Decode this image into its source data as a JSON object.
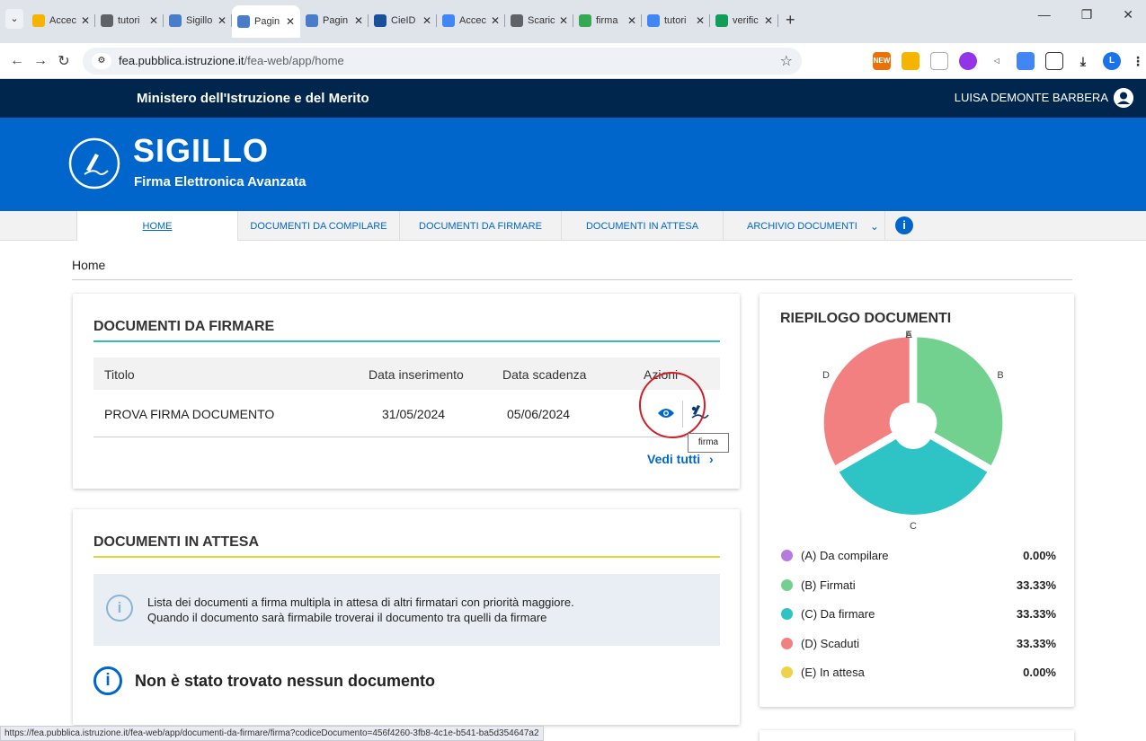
{
  "browser": {
    "tabs": [
      {
        "label": "Accec",
        "color": "#f4b400"
      },
      {
        "label": "tutori",
        "color": "#5f6368"
      },
      {
        "label": "Sigillo",
        "color": "#4a7cc9"
      },
      {
        "label": "Pagin",
        "color": "#4a7cc9"
      },
      {
        "label": "Pagin",
        "color": "#4a7cc9"
      },
      {
        "label": "CieID",
        "color": "#1a4f9c"
      },
      {
        "label": "Accec",
        "color": "#4285f4"
      },
      {
        "label": "Scaric",
        "color": "#5f6368"
      },
      {
        "label": "firma",
        "color": "#34a853"
      },
      {
        "label": "tutori",
        "color": "#4285f4"
      },
      {
        "label": "verific",
        "color": "#0f9d58"
      }
    ],
    "new_tab": "+",
    "url_host": "fea.pubblica.istruzione.it",
    "url_path": "/fea-web/app/home",
    "status_url": "https://fea.pubblica.istruzione.it/fea-web/app/documenti-da-firmare/firma?codiceDocumento=456f4260-3fb8-4c1e-b541-ba5d354647a2",
    "new_badge": "NEW",
    "profile_initial": "L"
  },
  "header": {
    "ministry": "Ministero dell'Istruzione e del Merito",
    "user": "LUISA DEMONTE BARBERA",
    "app_name": "SIGILLO",
    "app_subtitle": "Firma Elettronica Avanzata"
  },
  "nav": {
    "items": [
      "HOME",
      "DOCUMENTI DA COMPILARE",
      "DOCUMENTI DA FIRMARE",
      "DOCUMENTI IN ATTESA",
      "ARCHIVIO DOCUMENTI"
    ],
    "info": "i"
  },
  "breadcrumb": "Home",
  "firmare": {
    "title": "DOCUMENTI DA FIRMARE",
    "accent": "#2ebfbf",
    "columns": [
      "Titolo",
      "Data inserimento",
      "Data scadenza",
      "Azioni"
    ],
    "rows": [
      {
        "titolo": "PROVA FIRMA DOCUMENTO",
        "inserimento": "31/05/2024",
        "scadenza": "05/06/2024"
      }
    ],
    "tooltip": "firma",
    "vedi_tutti": "Vedi tutti"
  },
  "attesa": {
    "title": "DOCUMENTI IN ATTESA",
    "accent": "#e6d33c",
    "info_line1": "Lista dei documenti a firma multipla in attesa di altri firmatari con priorità maggiore.",
    "info_line2": "Quando il documento sarà firmabile troverai il documento tra quelli da firmare",
    "empty": "Non è stato trovato nessun documento"
  },
  "riepilogo": {
    "title": "RIEPILOGO DOCUMENTI",
    "legend": [
      {
        "label": "(A) Da compilare",
        "value": "0.00%",
        "color": "#b57be0"
      },
      {
        "label": "(B) Firmati",
        "value": "33.33%",
        "color": "#72d18f"
      },
      {
        "label": "(C) Da firmare",
        "value": "33.33%",
        "color": "#2ec4c6"
      },
      {
        "label": "(D) Scaduti",
        "value": "33.33%",
        "color": "#f28080"
      },
      {
        "label": "(E) In attesa",
        "value": "0.00%",
        "color": "#eed24a"
      }
    ]
  },
  "chart_data": {
    "type": "pie",
    "categories": [
      "A",
      "B",
      "C",
      "D",
      "E"
    ],
    "values": [
      0,
      33.33,
      33.33,
      33.33,
      0
    ],
    "colors": [
      "#b57be0",
      "#72d18f",
      "#2ec4c6",
      "#f28080",
      "#eed24a"
    ],
    "donut": true
  }
}
